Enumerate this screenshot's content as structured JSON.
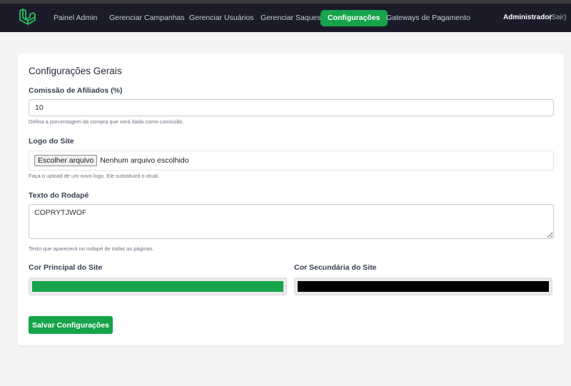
{
  "nav": {
    "items": [
      {
        "label": "Painel Admin",
        "active": false
      },
      {
        "label": "Gerenciar Campanhas",
        "active": false
      },
      {
        "label": "Gerenciar Usuários",
        "active": false
      },
      {
        "label": "Gerenciar Saques",
        "active": false
      },
      {
        "label": "Configurações",
        "active": true
      },
      {
        "label": "Gateways de Pagamento",
        "active": false
      }
    ],
    "user": "Administrador",
    "logout": "(Sair)",
    "logo_icon": "laravel-logo-icon",
    "accent_color": "#16a34a",
    "bg_color": "#1b1b2a"
  },
  "settings": {
    "title": "Configurações Gerais",
    "commission": {
      "label": "Comissão de Afiliados (%)",
      "value": "10",
      "help": "Defina a porcentagem da compra que será dada como comissão."
    },
    "logo": {
      "label": "Logo do Site",
      "button": "Escolher arquivo",
      "status": "Nenhum arquivo escolhido",
      "help": "Faça o upload de um novo logo. Ele substituirá o atual."
    },
    "footer": {
      "label": "Texto do Rodapé",
      "value": "COPRYTJWOF",
      "help": "Texto que aparecerá no rodapé de todas as páginas."
    },
    "primary_color": {
      "label": "Cor Principal do Site",
      "value": "#16a34a"
    },
    "secondary_color": {
      "label": "Cor Secundária do Site",
      "value": "#000000"
    },
    "save_label": "Salvar Configurações"
  }
}
